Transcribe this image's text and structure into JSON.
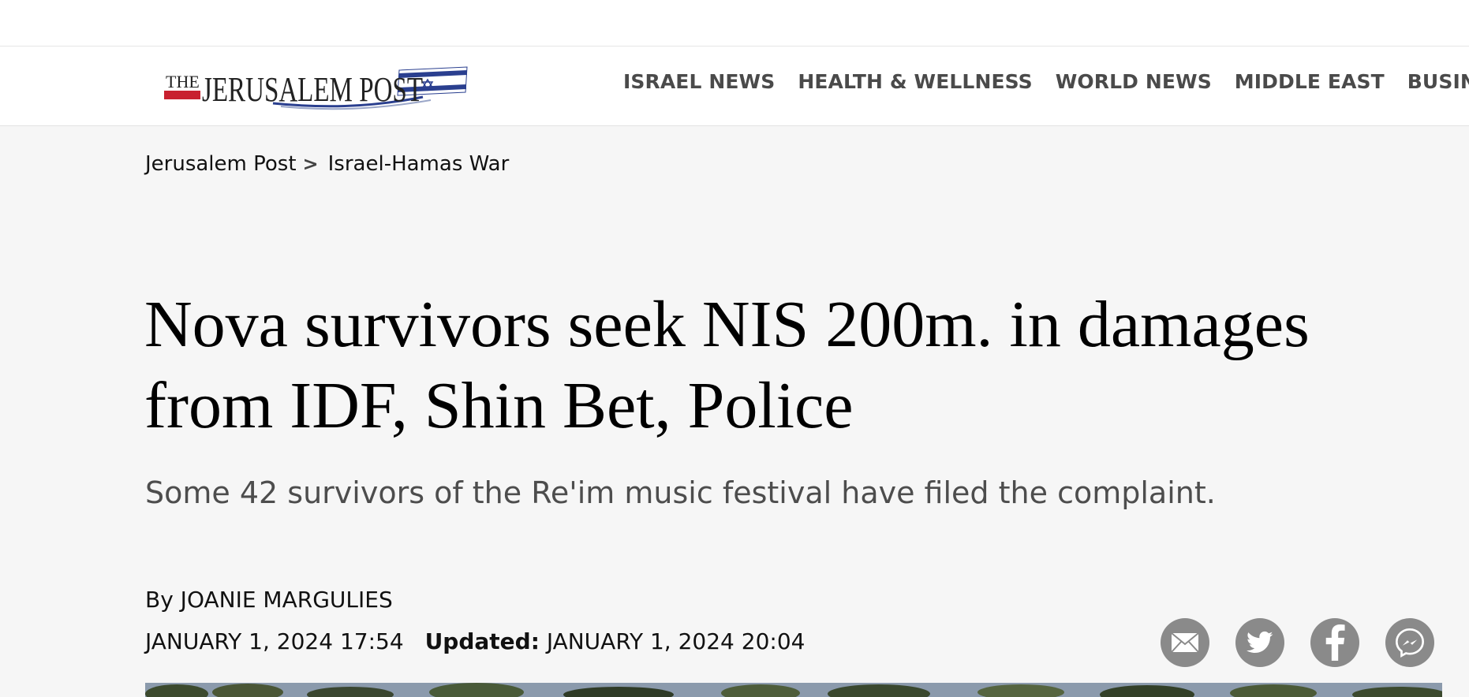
{
  "logo_text": "THE JERUSALEM POST",
  "nav": [
    "ISRAEL NEWS",
    "HEALTH & WELLNESS",
    "WORLD NEWS",
    "MIDDLE EAST",
    "BUSINESS & I"
  ],
  "breadcrumb": {
    "home": "Jerusalem Post",
    "separator": ">",
    "section": "Israel-Hamas War"
  },
  "article": {
    "headline": "Nova survivors seek NIS 200m. in damages from IDF, Shin Bet, Police",
    "subtitle": "Some 42 survivors of the Re'im music festival have filed the complaint.",
    "byline": "By JOANIE MARGULIES",
    "published": "JANUARY 1, 2024 17:54",
    "updated_label": "Updated:",
    "updated": "JANUARY 1, 2024 20:04"
  },
  "share_icons": [
    "mail-icon",
    "twitter-icon",
    "facebook-icon",
    "messenger-icon"
  ],
  "colors": {
    "nav_text": "#4a4a4a",
    "share_icon_bg": "#8a8a8a",
    "logo_red": "#c8202f",
    "logo_blue": "#2a3f8f",
    "page_bg": "#f6f6f6"
  }
}
